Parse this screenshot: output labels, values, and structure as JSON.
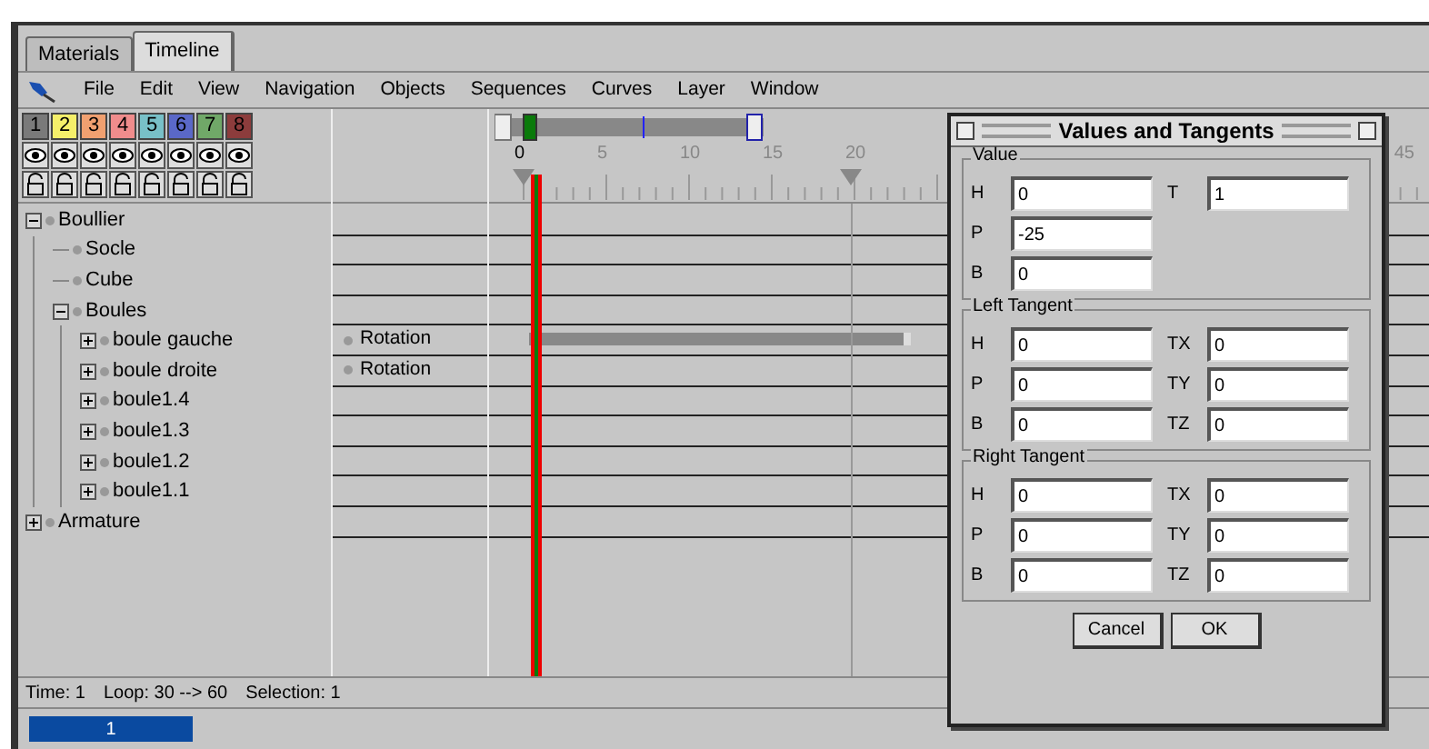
{
  "tabs": [
    {
      "label": "Materials",
      "selected": false
    },
    {
      "label": "Timeline",
      "selected": true
    }
  ],
  "menu": [
    "File",
    "Edit",
    "View",
    "Navigation",
    "Objects",
    "Sequences",
    "Curves",
    "Layer",
    "Window"
  ],
  "layers": [
    {
      "label": "1",
      "color": "#7a7a7a"
    },
    {
      "label": "2",
      "color": "#f5ef6a"
    },
    {
      "label": "3",
      "color": "#f0a070"
    },
    {
      "label": "4",
      "color": "#f08c8c"
    },
    {
      "label": "5",
      "color": "#78c0c8"
    },
    {
      "label": "6",
      "color": "#5a68c8"
    },
    {
      "label": "7",
      "color": "#70a868"
    },
    {
      "label": "8",
      "color": "#8c3c3c"
    }
  ],
  "tree": [
    {
      "name": "Boullier",
      "expanded": true,
      "sequence": false,
      "children": [
        {
          "name": "Socle",
          "sequence": false
        },
        {
          "name": "Cube",
          "sequence": false
        },
        {
          "name": "Boules",
          "expanded": true,
          "sequence": false,
          "children": [
            {
              "name": "boule gauche",
              "expanded": false,
              "track": "Rotation",
              "sequence": true
            },
            {
              "name": "boule droite",
              "expanded": false,
              "track": "Rotation",
              "sequence": false
            },
            {
              "name": "boule1.4",
              "expanded": false,
              "sequence": false
            },
            {
              "name": "boule1.3",
              "expanded": false,
              "sequence": false
            },
            {
              "name": "boule1.2",
              "expanded": false,
              "sequence": false
            },
            {
              "name": "boule1.1",
              "expanded": false,
              "sequence": false
            }
          ]
        }
      ]
    },
    {
      "name": "Armature",
      "expanded": false,
      "sequence": false
    }
  ],
  "ruler_labels": [
    "0",
    "5",
    "10",
    "15",
    "20",
    "45"
  ],
  "status": [
    "Time: 1",
    "Loop: 30 --> 60",
    "Selection: 1"
  ],
  "time_field": {
    "value": "1"
  },
  "dialog": {
    "title": "Values and Tangents",
    "groups": [
      {
        "title": "Value",
        "rows": [
          [
            {
              "label": "H",
              "value": "0"
            },
            {
              "label": "T",
              "value": "1"
            }
          ],
          [
            {
              "label": "P",
              "value": "-25"
            }
          ],
          [
            {
              "label": "B",
              "value": "0"
            }
          ]
        ]
      },
      {
        "title": "Left Tangent",
        "rows": [
          [
            {
              "label": "H",
              "value": "0"
            },
            {
              "label": "TX",
              "value": "0"
            }
          ],
          [
            {
              "label": "P",
              "value": "0"
            },
            {
              "label": "TY",
              "value": "0"
            }
          ],
          [
            {
              "label": "B",
              "value": "0"
            },
            {
              "label": "TZ",
              "value": "0"
            }
          ]
        ]
      },
      {
        "title": "Right Tangent",
        "rows": [
          [
            {
              "label": "H",
              "value": "0"
            },
            {
              "label": "TX",
              "value": "0"
            }
          ],
          [
            {
              "label": "P",
              "value": "0"
            },
            {
              "label": "TY",
              "value": "0"
            }
          ],
          [
            {
              "label": "B",
              "value": "0"
            },
            {
              "label": "TZ",
              "value": "0"
            }
          ]
        ]
      }
    ],
    "buttons": [
      "Cancel",
      "OK"
    ]
  }
}
